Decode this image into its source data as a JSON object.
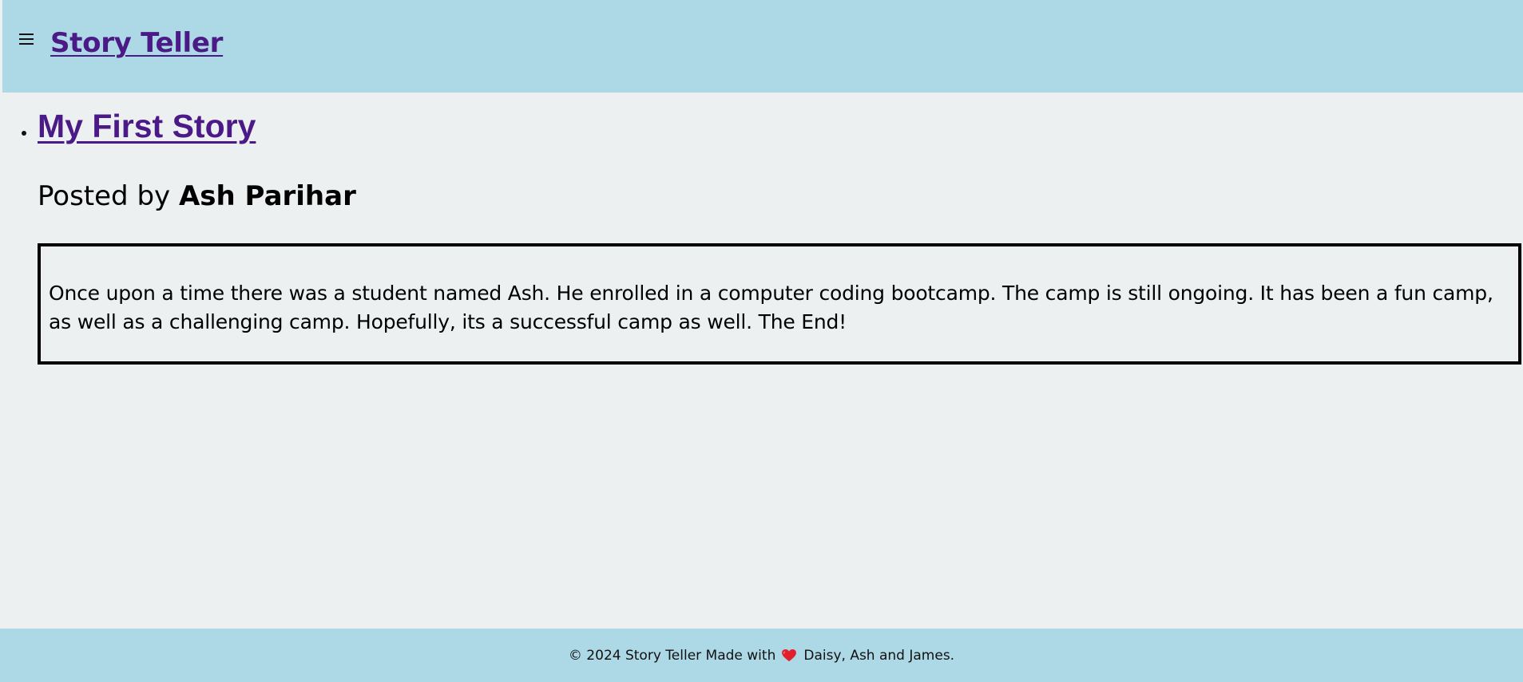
{
  "header": {
    "menu_icon": "hamburger-menu-icon",
    "site_title": "Story Teller",
    "background_color": "#ADD8E6",
    "title_color": "#4B1A86"
  },
  "main": {
    "stories": [
      {
        "title": "My First Story",
        "posted_by_label": "Posted by",
        "author": "Ash Parihar",
        "body": "Once upon a time there was a student named Ash. He enrolled in a computer coding bootcamp. The camp is still ongoing. It has been a fun camp, as well as a challenging camp. Hopefully, its a successful camp as well. The End!"
      }
    ],
    "background_color": "#ECF0F1"
  },
  "footer": {
    "text_before": "© 2024 Story Teller Made with",
    "heart_icon": "heart-icon",
    "text_after": "Daisy, Ash and James.",
    "heart_color": "#E0202C",
    "background_color": "#ADD8E6"
  }
}
